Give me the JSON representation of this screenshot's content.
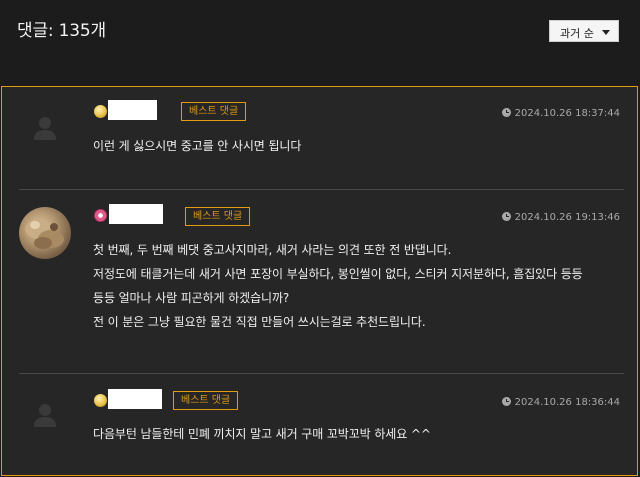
{
  "header": {
    "comment_count_label": "댓글: 135개",
    "sort_selected": "과거 순"
  },
  "comments": [
    {
      "badge": "베스트 댓글",
      "timestamp": "2024.10.26 18:37:44",
      "lines": [
        "이런 게 싫으시면 중고를 안 사시면 됩니다"
      ],
      "avatar": "default-user-icon"
    },
    {
      "badge": "베스트 댓글",
      "timestamp": "2024.10.26 19:13:46",
      "lines": [
        "첫 번째,  두 번째 베댓 중고사지마라, 새거 사라는 의견 또한 전 반댑니다.",
        "저정도에 태클거는데 새거 사면 포장이 부실하다,  봉인씰이 없다,  스티커 지저분하다,  흠집있다 등등",
        "등등  얼마나 사람 피곤하게 하겠습니까?",
        "전 이 분은 그냥 필요한 물건 직접 만들어 쓰시는걸로 추천드립니다."
      ],
      "avatar": "photo-avatar"
    },
    {
      "badge": "베스트 댓글",
      "timestamp": "2024.10.26 18:36:44",
      "lines": [
        "다음부턴 남들한테 민폐 끼치지 말고 새거 구매 꼬박꼬박 하세요 ^^"
      ],
      "avatar": "default-user-icon"
    }
  ],
  "colors": {
    "accent": "#e19a12",
    "background": "#1c1c1c",
    "panel": "#262626"
  }
}
